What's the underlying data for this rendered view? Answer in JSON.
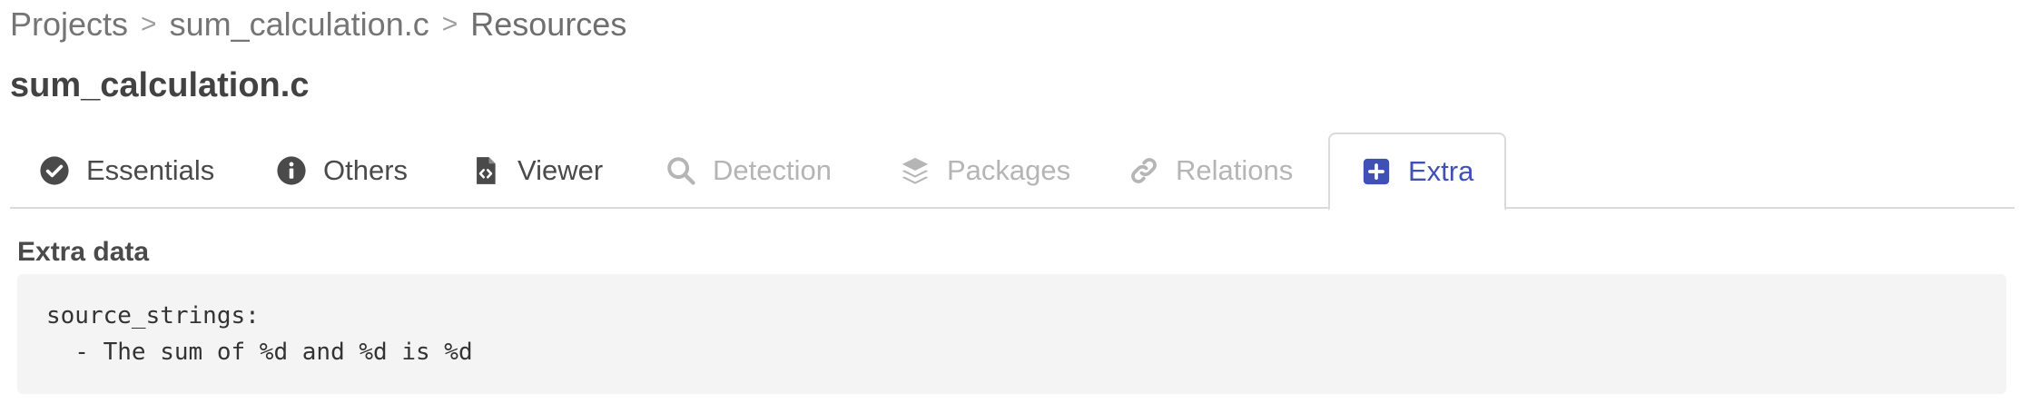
{
  "breadcrumb": {
    "items": [
      "Projects",
      "sum_calculation.c",
      "Resources"
    ],
    "separator": ">"
  },
  "title": "sum_calculation.c",
  "tabs": [
    {
      "label": "Essentials",
      "icon": "check-circle-icon",
      "state": "enabled"
    },
    {
      "label": "Others",
      "icon": "info-circle-icon",
      "state": "enabled"
    },
    {
      "label": "Viewer",
      "icon": "file-code-icon",
      "state": "enabled"
    },
    {
      "label": "Detection",
      "icon": "search-icon",
      "state": "disabled"
    },
    {
      "label": "Packages",
      "icon": "layers-icon",
      "state": "disabled"
    },
    {
      "label": "Relations",
      "icon": "link-icon",
      "state": "disabled"
    },
    {
      "label": "Extra",
      "icon": "plus-square-icon",
      "state": "active"
    }
  ],
  "extra": {
    "section_title": "Extra data",
    "content": "source_strings:\n  - The sum of %d and %d is %d"
  },
  "colors": {
    "active": "#3f51b5",
    "text": "#4a4a4a",
    "disabled": "#b5b5b5",
    "code_bg": "#f4f4f4",
    "border": "#dbdbdb"
  }
}
